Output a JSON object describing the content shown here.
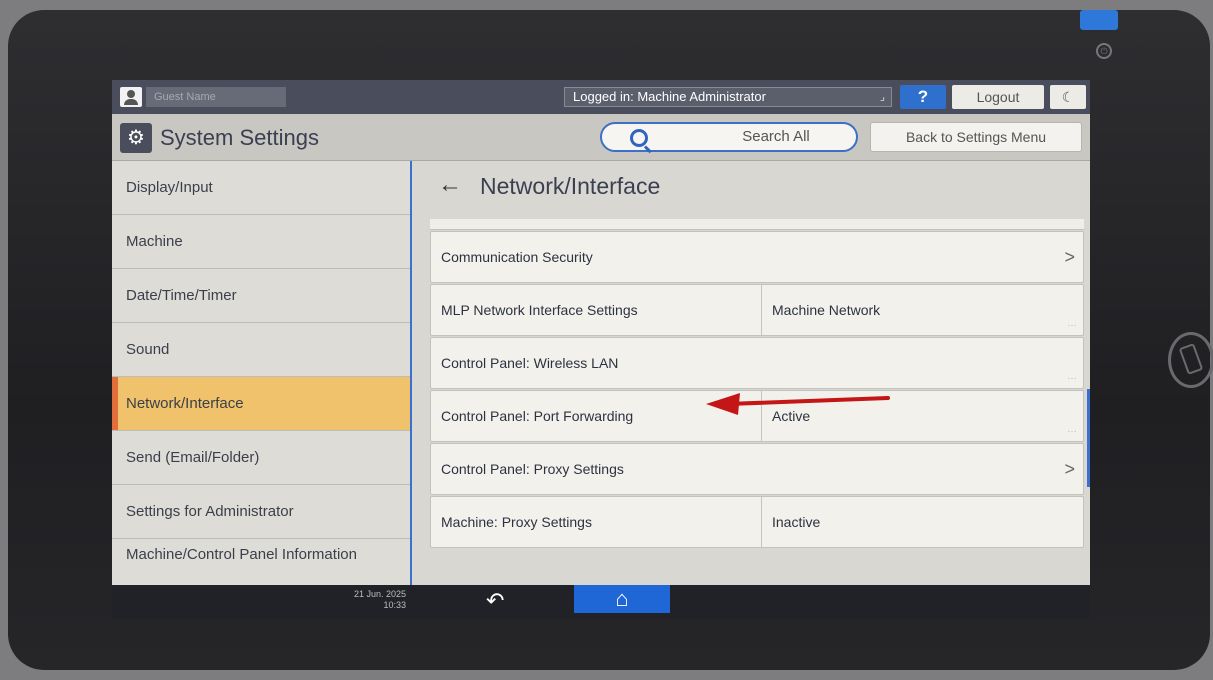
{
  "topbar": {
    "user_field": "Guest Name",
    "logged_in": "Logged in: Machine Administrator",
    "help_label": "?",
    "logout_label": "Logout",
    "moon_label": "☾"
  },
  "header": {
    "title": "System Settings",
    "search_label": "Search All",
    "back_label": "Back to Settings Menu"
  },
  "sidebar": {
    "items": [
      {
        "label": "Display/Input"
      },
      {
        "label": "Machine"
      },
      {
        "label": "Date/Time/Timer"
      },
      {
        "label": "Sound"
      },
      {
        "label": "Network/Interface",
        "selected": true
      },
      {
        "label": "Send (Email/Folder)"
      },
      {
        "label": "Settings for Administrator"
      },
      {
        "label": "Machine/Control Panel Information"
      }
    ]
  },
  "main": {
    "title": "Network/Interface",
    "back_arrow": "←",
    "rows": [
      {
        "label": "Communication Security",
        "value": "",
        "chevron": ">"
      },
      {
        "label": "MLP Network Interface Settings",
        "value": "Machine Network",
        "chevron": ""
      },
      {
        "label": "Control Panel: Wireless LAN",
        "value": "",
        "chevron": ""
      },
      {
        "label": "Control Panel: Port Forwarding",
        "value": "Active",
        "chevron": ""
      },
      {
        "label": "Control Panel: Proxy Settings",
        "value": "",
        "chevron": ">"
      },
      {
        "label": "Machine: Proxy Settings",
        "value": "Inactive",
        "chevron": ""
      }
    ]
  },
  "bottombar": {
    "date": "21 Jun. 2025",
    "time": "10:33",
    "undo_icon": "↶",
    "home_icon": "⌂"
  },
  "colors": {
    "accent_blue": "#3b6fd0",
    "selected_bg": "#efc26b",
    "selected_marker": "#e06f3b",
    "annotation_red": "#c41616"
  }
}
